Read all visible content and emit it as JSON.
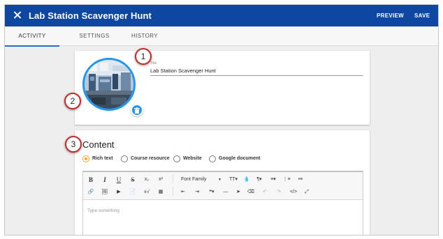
{
  "header": {
    "title": "Lab Station Scavenger Hunt",
    "close_icon": "close-icon",
    "preview_label": "PREVIEW",
    "save_label": "SAVE",
    "bg_color": "#0d47a1"
  },
  "tabs": [
    {
      "label": "ACTIVITY",
      "active": true
    },
    {
      "label": "SETTINGS",
      "active": false
    },
    {
      "label": "HISTORY",
      "active": false
    }
  ],
  "title_card": {
    "field_label": "Title",
    "field_value": "Lab Station Scavenger Hunt",
    "avatar_icon": "lab-photo-avatar",
    "delete_icon": "trash-icon",
    "accent_color": "#2196f3"
  },
  "content_card": {
    "heading": "Content",
    "radio_options": [
      {
        "label": "Rich text",
        "selected": true
      },
      {
        "label": "Course resource",
        "selected": false
      },
      {
        "label": "Website",
        "selected": false
      },
      {
        "label": "Google document",
        "selected": false
      }
    ],
    "editor": {
      "placeholder": "Type something",
      "toolbar_row1": [
        {
          "label": "B",
          "icon": "bold-icon"
        },
        {
          "label": "I",
          "icon": "italic-icon"
        },
        {
          "label": "U",
          "icon": "underline-icon"
        },
        {
          "label": "S",
          "icon": "strikethrough-icon"
        },
        {
          "label": "x₂",
          "icon": "subscript-icon"
        },
        {
          "label": "x²",
          "icon": "superscript-icon"
        },
        {
          "label": "Font Family",
          "icon": "font-family-select"
        },
        {
          "label": "TT▾",
          "icon": "font-size-icon"
        },
        {
          "label": "💧",
          "icon": "color-icon"
        },
        {
          "label": "¶▾",
          "icon": "paragraph-format-icon"
        },
        {
          "label": "≡▾",
          "icon": "align-icon"
        },
        {
          "label": "⋮≡",
          "icon": "ordered-list-icon"
        },
        {
          "label": "•≡",
          "icon": "unordered-list-icon"
        }
      ],
      "toolbar_row2": [
        {
          "label": "🔗",
          "icon": "link-icon"
        },
        {
          "label": "🖼",
          "icon": "image-icon"
        },
        {
          "label": "▶",
          "icon": "video-icon"
        },
        {
          "label": "📄",
          "icon": "file-icon"
        },
        {
          "label": "±√",
          "icon": "special-characters-icon"
        },
        {
          "label": "▦",
          "icon": "table-icon"
        },
        {
          "label": "⇤",
          "icon": "outdent-icon"
        },
        {
          "label": "⇥",
          "icon": "indent-icon"
        },
        {
          "label": "❝▾",
          "icon": "quote-icon"
        },
        {
          "label": "—",
          "icon": "horizontal-line-icon"
        },
        {
          "label": "➤",
          "icon": "cursor-icon"
        },
        {
          "label": "⌫",
          "icon": "clear-formatting-icon"
        },
        {
          "label": "↶",
          "icon": "undo-icon"
        },
        {
          "label": "↷",
          "icon": "redo-icon"
        },
        {
          "label": "</>",
          "icon": "code-view-icon"
        },
        {
          "label": "⤢",
          "icon": "fullscreen-icon"
        }
      ]
    }
  },
  "callouts": [
    "1",
    "2",
    "3"
  ],
  "colors": {
    "callout_border": "#c62828",
    "radio_selected": "#f9a825",
    "tab_indicator": "#1e6fd0"
  }
}
